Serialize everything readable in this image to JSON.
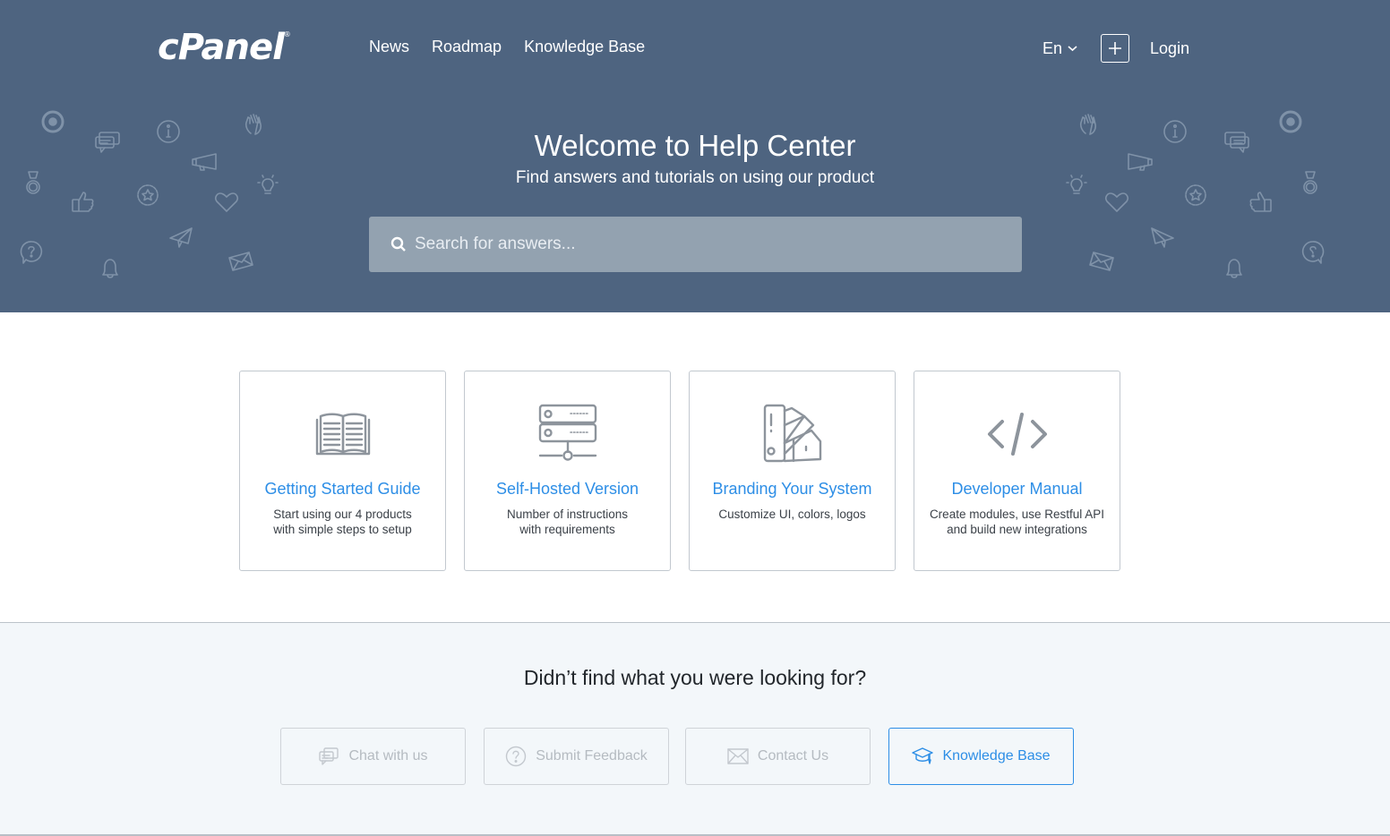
{
  "header": {
    "logo": "cPanel",
    "logo_mark": "®",
    "nav": [
      {
        "label": "News"
      },
      {
        "label": "Roadmap"
      },
      {
        "label": "Knowledge Base"
      }
    ],
    "language": "En",
    "login_label": "Login"
  },
  "hero": {
    "title": "Welcome to Help Center",
    "subtitle": "Find answers and tutorials on using our product",
    "search_placeholder": "Search for answers..."
  },
  "cards": [
    {
      "icon": "open-book-icon",
      "title": "Getting Started Guide",
      "desc_line1": "Start using our 4 products",
      "desc_line2": "with simple steps to setup"
    },
    {
      "icon": "server-icon",
      "title": "Self-Hosted Version",
      "desc_line1": "Number of instructions",
      "desc_line2": "with requirements"
    },
    {
      "icon": "color-palette-icon",
      "title": "Branding Your System",
      "desc_line1": "Customize UI, colors, logos",
      "desc_line2": ""
    },
    {
      "icon": "code-icon",
      "title": "Developer Manual",
      "desc_line1": "Create modules, use Restful API",
      "desc_line2": "and build new integrations"
    }
  ],
  "help": {
    "title": "Didn’t find what you were looking for?",
    "actions": [
      {
        "icon": "chat-bubbles-icon",
        "label": "Chat with us"
      },
      {
        "icon": "question-circle-icon",
        "label": "Submit Feedback"
      },
      {
        "icon": "envelope-icon",
        "label": "Contact Us"
      },
      {
        "icon": "graduation-cap-icon",
        "label": "Knowledge Base",
        "active": true
      }
    ]
  },
  "colors": {
    "hero_bg": "#4e6480",
    "accent": "#2d8ee6",
    "bottom_bg": "#f3f7fa"
  }
}
